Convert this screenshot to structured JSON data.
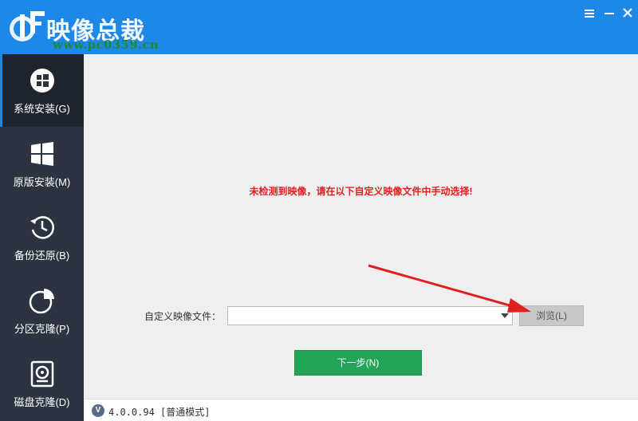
{
  "app": {
    "title": "映像总裁",
    "watermark": "www.pc0359.cn"
  },
  "sidebar": {
    "items": [
      {
        "label": "系统安装(G)",
        "icon": "windows-logo-circle-icon",
        "active": true
      },
      {
        "label": "原版安装(M)",
        "icon": "windows-logo-icon",
        "active": false
      },
      {
        "label": "备份还原(B)",
        "icon": "clock-restore-icon",
        "active": false
      },
      {
        "label": "分区克隆(P)",
        "icon": "pie-chart-icon",
        "active": false
      },
      {
        "label": "磁盘克隆(D)",
        "icon": "disk-icon",
        "active": false
      }
    ]
  },
  "main": {
    "notice": "未检测到映像，请在以下自定义映像文件中手动选择!",
    "file_label": "自定义映像文件：",
    "file_value": "",
    "browse_label": "浏览(L)",
    "next_label": "下一步(N)"
  },
  "status": {
    "version_icon": "V",
    "version_text": "4.0.0.94 [普通模式]"
  },
  "colors": {
    "titlebar": "#1d88e5",
    "sidebar": "#2c3442",
    "notice": "#e02020",
    "next_button": "#20a457",
    "annotation_arrow": "#e02020"
  }
}
